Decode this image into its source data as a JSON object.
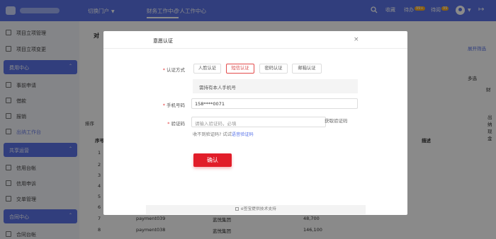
{
  "header": {
    "switch_portal": "切换门户",
    "nav_finance": "财务工作中心",
    "nav_personal": "个人工作中心",
    "favorites": "收藏",
    "todo": "待办",
    "todo_badge": "99+",
    "pending_read": "待阅",
    "pending_badge": "99"
  },
  "sidebar": {
    "items": [
      {
        "label": "项目立项管理"
      },
      {
        "label": "项目立项变更"
      },
      {
        "label": "事前申请"
      },
      {
        "label": "借款"
      },
      {
        "label": "报销"
      },
      {
        "label": "出纳工作台"
      },
      {
        "label": "信用台帐"
      },
      {
        "label": "信用申诉"
      },
      {
        "label": "交单管理"
      },
      {
        "label": "合同台帐"
      }
    ],
    "groups": [
      {
        "label": "费用中心"
      },
      {
        "label": "共享运营"
      },
      {
        "label": "合同中心"
      }
    ]
  },
  "background": {
    "tab_label": "对",
    "expand": "展开筛选",
    "multi": "多选",
    "right_label": "财",
    "right_vertical": [
      "出",
      "纳",
      "现",
      "金"
    ],
    "sort_label": "排序",
    "sequence_header": "序号",
    "description_header": "描述",
    "row_numbers": [
      "1",
      "2",
      "3",
      "4",
      "5",
      "6",
      "7",
      "8"
    ],
    "visible_rows": [
      {
        "no": "7",
        "payment": "payment039",
        "company": "蓝悦集团",
        "amount": "48,700"
      },
      {
        "no": "8",
        "payment": "payment038",
        "company": "蓝悦集团",
        "amount": "146,100"
      }
    ]
  },
  "modal": {
    "title": "意愿认证",
    "close_icon": "close-icon",
    "method_label": "认证方式",
    "methods": [
      {
        "label": "人脸认证"
      },
      {
        "label": "短信认证"
      },
      {
        "label": "密码认证"
      },
      {
        "label": "邮箱认证"
      }
    ],
    "hint": "需持有本人手机号",
    "phone_label": "手机号码",
    "phone_value": "158****0071",
    "code_label": "验证码",
    "code_placeholder": "请输入验证码，必填",
    "get_code": "获取验证码",
    "voice_prefix": "收不到验证码? 试试",
    "voice_link": "语音验证码",
    "confirm": "确认",
    "footer": "e签宝提供技术支持"
  },
  "colors": {
    "brand_blue": "#5b73e8",
    "confirm_red": "#e11d29"
  }
}
